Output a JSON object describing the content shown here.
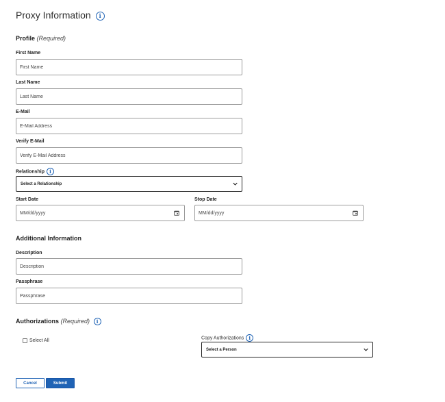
{
  "page": {
    "title": "Proxy Information"
  },
  "profile": {
    "heading": "Profile",
    "required_label": "(Required)",
    "first_name": {
      "label": "First Name",
      "placeholder": "First Name"
    },
    "last_name": {
      "label": "Last Name",
      "placeholder": "Last Name"
    },
    "email": {
      "label": "E-Mail",
      "placeholder": "E-Mail Address"
    },
    "verify_email": {
      "label": "Verify E-Mail",
      "placeholder": "Verify E-Mail Address"
    },
    "relationship": {
      "label": "Relationship",
      "selected": "Select a Relationship"
    },
    "start_date": {
      "label": "Start Date",
      "placeholder": "MM/dd/yyyy"
    },
    "stop_date": {
      "label": "Stop Date",
      "placeholder": "MM/dd/yyyy"
    }
  },
  "additional": {
    "heading": "Additional Information",
    "description": {
      "label": "Description",
      "placeholder": "Description"
    },
    "passphrase": {
      "label": "Passphrase",
      "placeholder": "Passphrase"
    }
  },
  "authorizations": {
    "heading": "Authorizations",
    "required_label": "(Required)",
    "select_all_label": "Select All",
    "copy": {
      "label": "Copy Authorizations",
      "selected": "Select a Person"
    }
  },
  "actions": {
    "cancel_label": "Cancel",
    "submit_label": "Submit"
  },
  "icons": {
    "info": "info-icon",
    "calendar": "calendar-icon",
    "chevron": "chevron-down-icon"
  },
  "colors": {
    "accent": "#1f63b5",
    "border": "#9a9a9a",
    "text": "#222222"
  }
}
